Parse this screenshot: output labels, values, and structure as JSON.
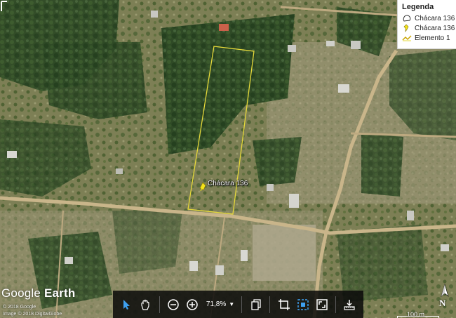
{
  "map": {
    "placemark_label": "Chácara 136",
    "colors": {
      "boundary": "#e6d93a",
      "vegetation_dense": "#2c4a24",
      "ground": "#8a8a5e",
      "road": "#c9b58a"
    }
  },
  "legend": {
    "title": "Legenda",
    "items": [
      {
        "label": "Chácara 136",
        "icon": "polygon-outline-icon"
      },
      {
        "label": "Chácara 136",
        "icon": "yellow-pin-icon"
      },
      {
        "label": "Elemento 1",
        "icon": "path-line-icon"
      }
    ]
  },
  "branding": {
    "logo_word1": "Google",
    "logo_word2": "Earth",
    "copyright_1": "© 2018 Google",
    "copyright_2": "Image © 2018 DigitalGlobe"
  },
  "toolbar": {
    "zoom_value": "71,8%",
    "buttons": [
      "select-arrow-icon",
      "pan-hand-icon",
      "zoom-out-icon",
      "zoom-in-icon",
      "copy-icon",
      "crop-icon",
      "fit-icon",
      "fullscreen-icon",
      "ruler-icon"
    ]
  },
  "scale": {
    "label": "100 m"
  },
  "compass": {
    "label": "N"
  }
}
